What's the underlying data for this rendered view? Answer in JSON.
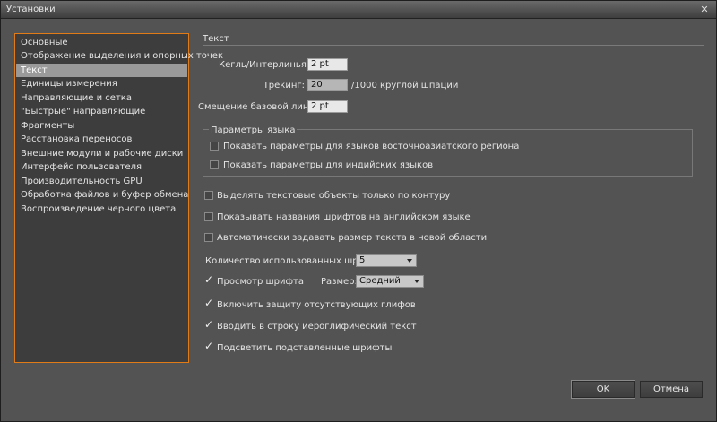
{
  "window": {
    "title": "Установки"
  },
  "sidebar": {
    "items": [
      {
        "label": "Основные"
      },
      {
        "label": "Отображение выделения и опорных точек"
      },
      {
        "label": "Текст"
      },
      {
        "label": "Единицы измерения"
      },
      {
        "label": "Направляющие и сетка"
      },
      {
        "label": "\"Быстрые\" направляющие"
      },
      {
        "label": "Фрагменты"
      },
      {
        "label": "Расстановка переносов"
      },
      {
        "label": "Внешние модули и рабочие диски"
      },
      {
        "label": "Интерфейс пользователя"
      },
      {
        "label": "Производительность GPU"
      },
      {
        "label": "Обработка файлов и буфер обмена"
      },
      {
        "label": "Воспроизведение черного цвета"
      }
    ],
    "active": "Текст"
  },
  "main": {
    "section_title": "Текст",
    "size_leading": {
      "label": "Кегль/Интерлиньяж:",
      "value": "2 pt"
    },
    "tracking": {
      "label": "Трекинг:",
      "value": "20",
      "suffix": "/1000 круглой шпации"
    },
    "baseline_shift": {
      "label": "Смещение базовой линии:",
      "value": "2 pt"
    },
    "language_group": {
      "title": "Параметры языка",
      "east_asian": "Показать параметры для языков восточноазиатского региона",
      "indic": "Показать параметры для индийских языков"
    },
    "select_outline_only": "Выделять текстовые объекты только по контуру",
    "english_font_names": "Показывать названия шрифтов на английском языке",
    "auto_size_text": "Автоматически задавать размер текста в новой области",
    "recent_fonts": {
      "label": "Количество использованных шрифтов",
      "value": "5"
    },
    "font_preview": {
      "label": "Просмотр шрифта",
      "size_label": "Размер:",
      "size_value": "Средний"
    },
    "missing_glyph": "Включить защиту отсутствующих глифов",
    "inline_input": "Вводить в строку иероглифический текст",
    "highlight_substituted": "Подсветить подставленные шрифты"
  },
  "buttons": {
    "ok": "OK",
    "cancel": "Отмена"
  },
  "colors": {
    "accent": "#e07b18",
    "panel": "#535353",
    "selected_item": "#9a9a9a"
  }
}
